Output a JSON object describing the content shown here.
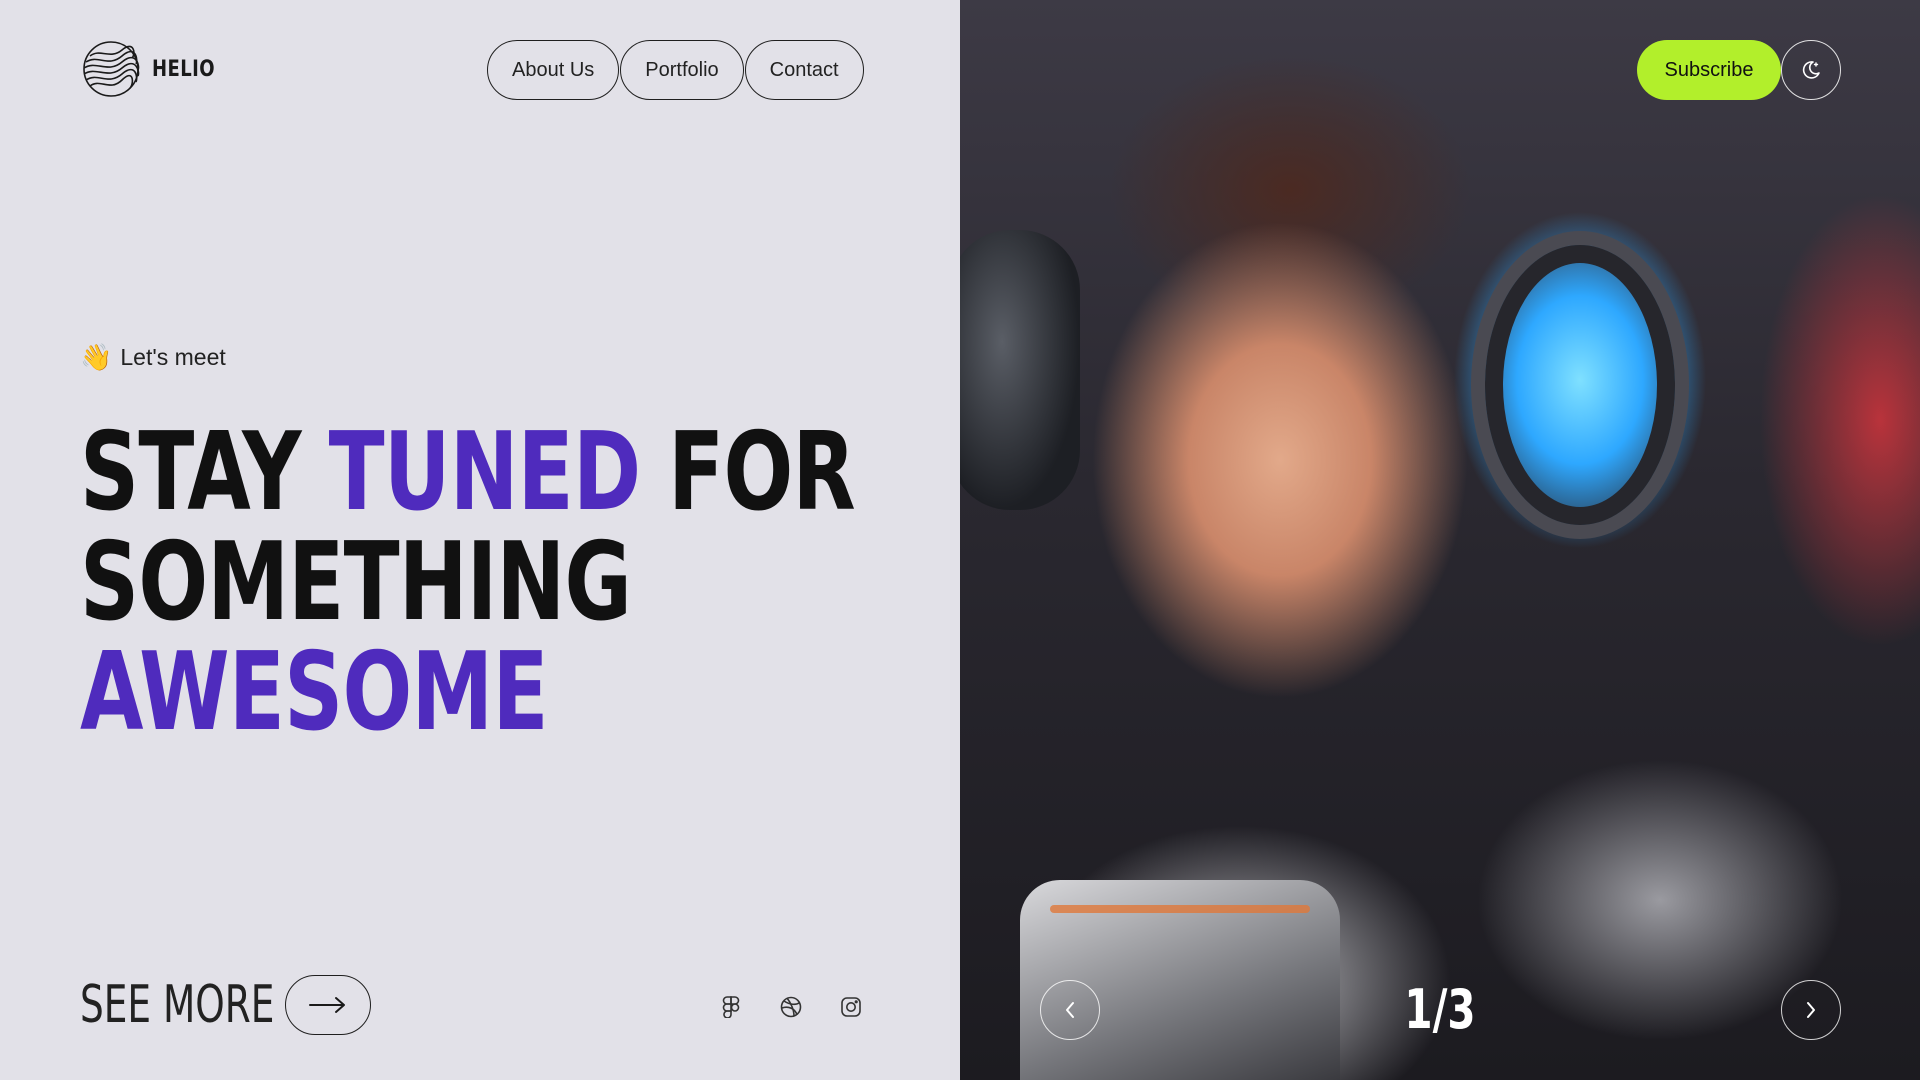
{
  "brand": {
    "name": "HELIO",
    "logo_icon": "wavy-sphere-logo"
  },
  "nav": {
    "items": [
      "About Us",
      "Portfolio",
      "Contact"
    ]
  },
  "header": {
    "subscribe_label": "Subscribe",
    "theme_icon": "moon-icon"
  },
  "hero": {
    "greeting_icon": "waving-hand-emoji",
    "greeting": "Let's meet",
    "headline": {
      "line1_a": "STAY ",
      "line1_b": "TUNED",
      "line1_c": " FOR",
      "line2": "SOMETHING",
      "line3": "AWESOME"
    },
    "accent_color": "#4f2bbd"
  },
  "cta": {
    "see_more_label": "SEE MORE",
    "arrow_icon": "arrow-right-icon"
  },
  "socials": [
    {
      "name": "figma",
      "icon": "figma-icon"
    },
    {
      "name": "dribbble",
      "icon": "dribbble-icon"
    },
    {
      "name": "instagram",
      "icon": "instagram-icon"
    }
  ],
  "slider": {
    "counter": "1/3",
    "current": 1,
    "total": 3,
    "prev_icon": "chevron-left-icon",
    "next_icon": "chevron-right-icon"
  },
  "colors": {
    "background": "#e2e1e8",
    "subscribe": "#b2ef2b",
    "accent": "#4f2bbd"
  }
}
